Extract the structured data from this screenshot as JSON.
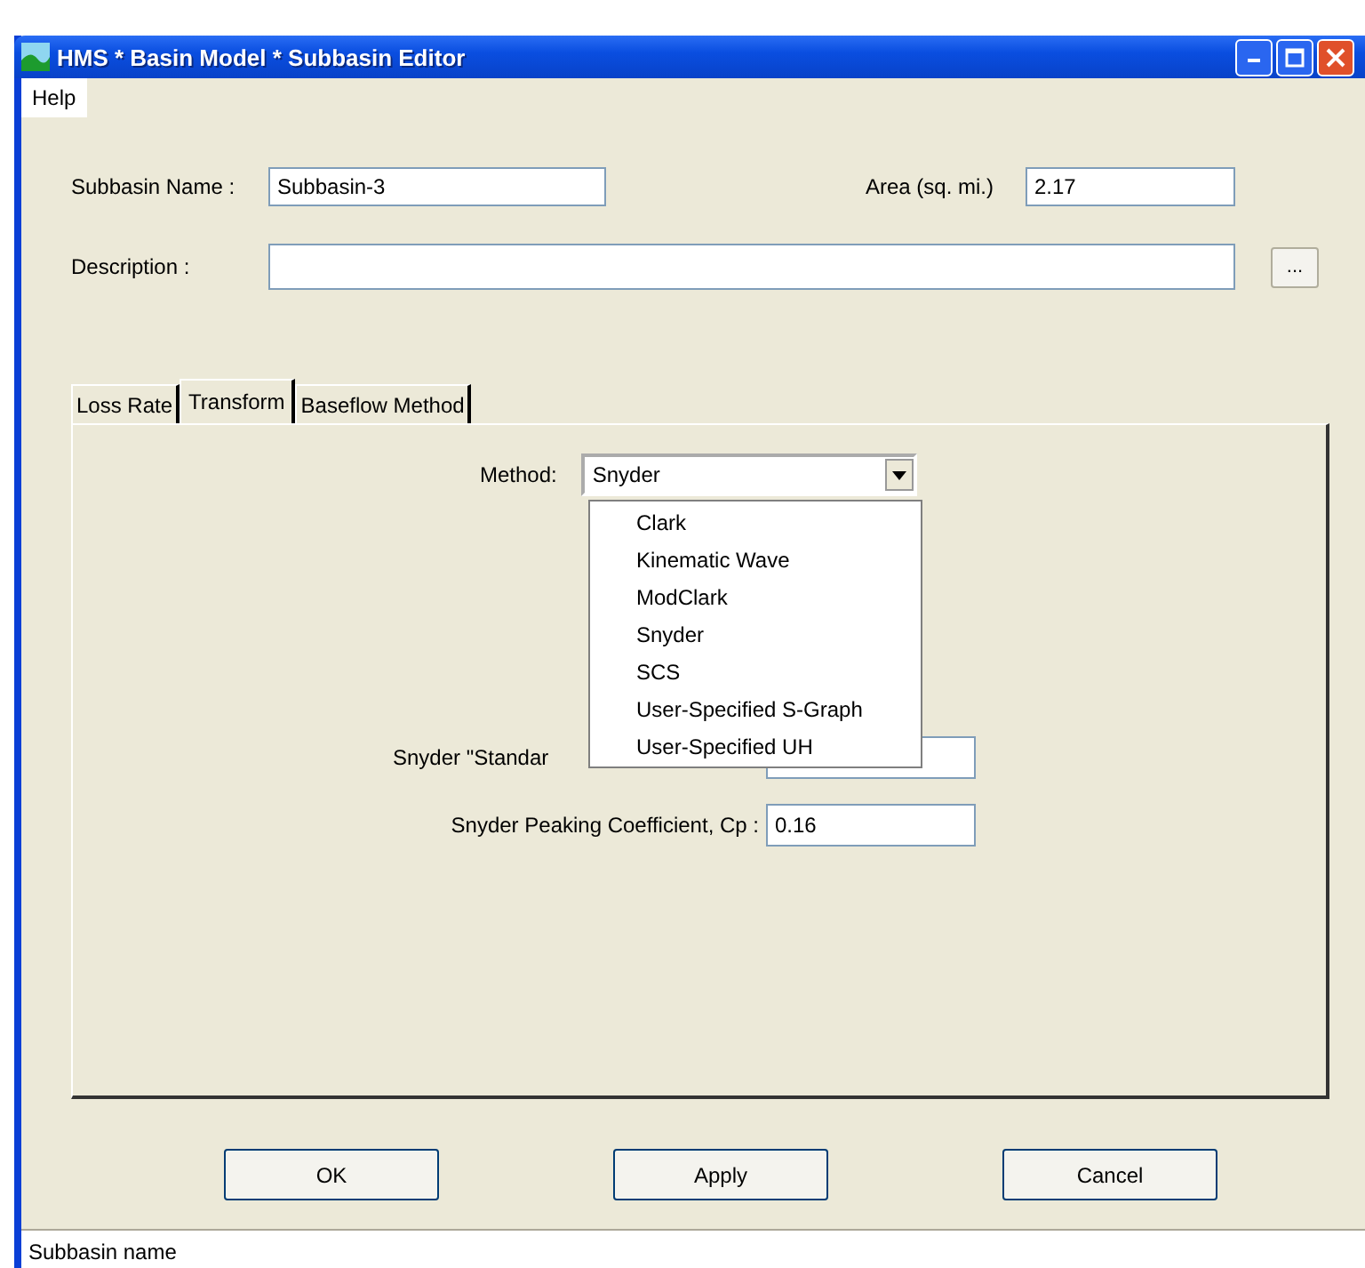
{
  "window": {
    "title": "HMS * Basin Model * Subbasin Editor"
  },
  "menu": [
    "Help"
  ],
  "subbasin_name": {
    "label": "Subbasin Name :",
    "value": "Subbasin-3"
  },
  "area": {
    "label": "Area (sq. mi.)",
    "value": "2.17"
  },
  "description": {
    "label": "Description :",
    "browse": "..."
  },
  "tabs": [
    {
      "label": "Loss Rate",
      "selected": false
    },
    {
      "label": "Transform",
      "selected": true
    },
    {
      "label": "Baseflow Method",
      "selected": false
    }
  ],
  "method": {
    "label": "Method:",
    "value": "Snyder",
    "options": [
      "Clark",
      "Kinematic Wave",
      "ModClark",
      "Snyder",
      "SCS",
      "User-Specified S-Graph",
      "User-Specified UH"
    ]
  },
  "parameters": [
    {
      "label": "Snyder \"Standar"
    },
    {
      "label": "Snyder Peaking Coefficient, Cp :",
      "value": "0.16"
    }
  ],
  "buttons": [
    "OK",
    "Apply",
    "Cancel"
  ],
  "status_bar": "Subbasin name"
}
